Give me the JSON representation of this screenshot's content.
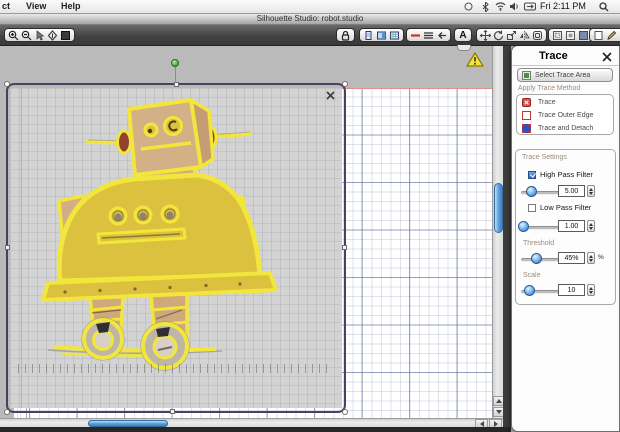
{
  "menubar": {
    "items": [
      "ct",
      "View",
      "Help"
    ],
    "clock": "Fri 2:11 PM"
  },
  "titlebar": {
    "title": "Silhouette Studio: robot.studio"
  },
  "toolbar": {
    "text_tool_label": "A"
  },
  "trace_panel": {
    "title": "Trace",
    "select_button": "Select Trace Area",
    "apply_method_label": "Apply Trace Method",
    "methods": [
      {
        "label": "Trace"
      },
      {
        "label": "Trace Outer Edge"
      },
      {
        "label": "Trace and Detach"
      }
    ],
    "settings_label": "Trace Settings",
    "high_pass": {
      "label": "High Pass Filter",
      "checked": true,
      "value": "5.00"
    },
    "low_pass": {
      "label": "Low Pass Filter",
      "checked": false,
      "value": "1.00"
    },
    "threshold": {
      "label": "Threshold",
      "value": "45%",
      "unit": "%"
    },
    "scale": {
      "label": "Scale",
      "value": "10"
    }
  },
  "colors": {
    "outline_yellow": "#f2e53c",
    "body_gold": "#dcc13e",
    "head_tan": "#d4b086",
    "selection_purple": "#4c4060",
    "aqua_scrollbar": "#5aa2e0"
  }
}
